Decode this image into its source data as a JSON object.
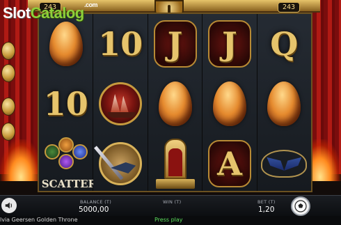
{
  "watermark": {
    "brand_part1": "Slot",
    "brand_part2": "Catalog",
    "brand_suffix": ".com"
  },
  "header": {
    "ways_left": "243",
    "ways_right": "243"
  },
  "reels": [
    [
      "egg",
      "10",
      "scatter"
    ],
    [
      "10",
      "ship",
      "dagger"
    ],
    [
      "J",
      "egg",
      "throne"
    ],
    [
      "J",
      "egg",
      "A"
    ],
    [
      "Q",
      "egg",
      "mask"
    ]
  ],
  "symbols": {
    "scatter_label": "SCATTER"
  },
  "infobar": {
    "balance_label": "BALANCE (T)",
    "balance_value": "5000,00",
    "win_label": "WIN (T)",
    "win_value": "",
    "bet_label": "BET (T)",
    "bet_value": "1,20"
  },
  "footer": {
    "game_title": "lvia Geersen Golden Throne",
    "status": "Press play"
  },
  "colors": {
    "gold": "#e6c46c",
    "accent_green": "#8ecf3a",
    "status_green": "#5de05d"
  }
}
